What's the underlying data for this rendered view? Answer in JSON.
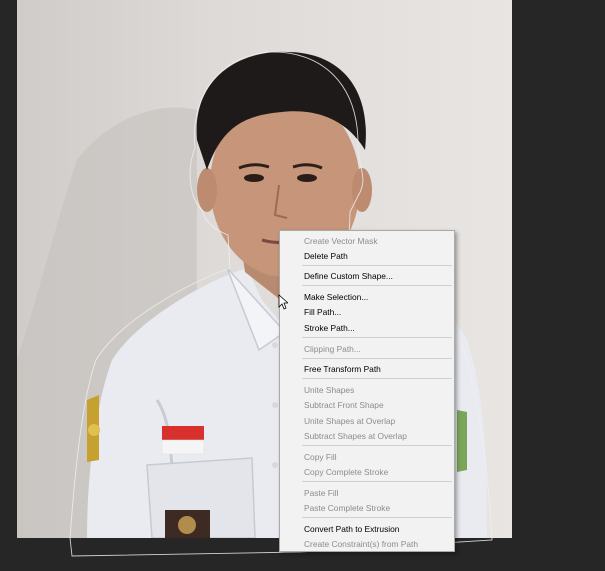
{
  "canvas": {
    "background": "#262626",
    "photo_background": "#dfdcd9"
  },
  "context_menu": {
    "items": [
      {
        "label": "Create Vector Mask",
        "enabled": false
      },
      {
        "label": "Delete Path",
        "enabled": true
      },
      {
        "label": "Define Custom Shape...",
        "enabled": true
      },
      {
        "label": "Make Selection...",
        "enabled": true
      },
      {
        "label": "Fill Path...",
        "enabled": true
      },
      {
        "label": "Stroke Path...",
        "enabled": true
      },
      {
        "label": "Clipping Path...",
        "enabled": false
      },
      {
        "label": "Free Transform Path",
        "enabled": true
      },
      {
        "label": "Unite Shapes",
        "enabled": false
      },
      {
        "label": "Subtract Front Shape",
        "enabled": false
      },
      {
        "label": "Unite Shapes at Overlap",
        "enabled": false
      },
      {
        "label": "Subtract Shapes at Overlap",
        "enabled": false
      },
      {
        "label": "Copy Fill",
        "enabled": false
      },
      {
        "label": "Copy Complete Stroke",
        "enabled": false
      },
      {
        "label": "Paste Fill",
        "enabled": false
      },
      {
        "label": "Paste Complete Stroke",
        "enabled": false
      },
      {
        "label": "Convert Path to Extrusion",
        "enabled": true
      },
      {
        "label": "Create Constraint(s) from Path",
        "enabled": false
      }
    ],
    "enabled_color": "#000000",
    "disabled_color": "#8c8c8c"
  }
}
